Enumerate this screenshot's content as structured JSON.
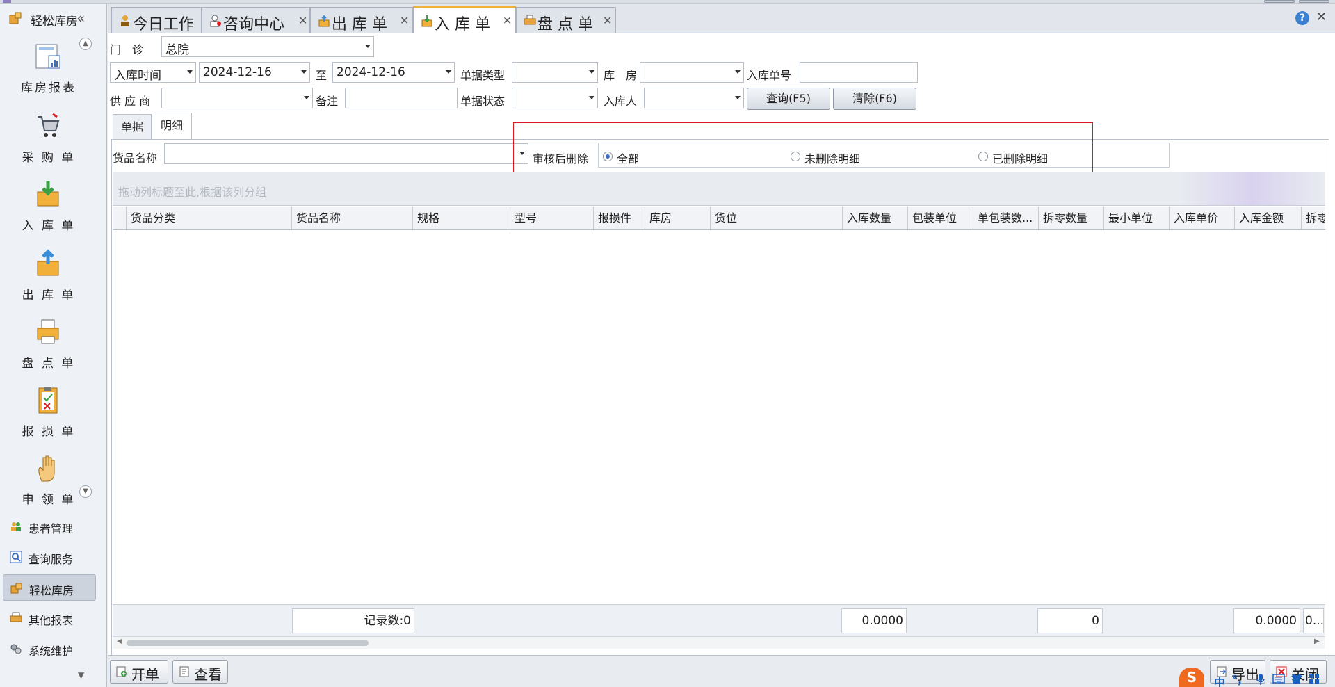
{
  "app": {
    "title": "轻松库房"
  },
  "sidebar": {
    "big_items": [
      {
        "label": "库房报表",
        "icon": "report-chart-icon"
      },
      {
        "label": "采 购 单",
        "icon": "cart-icon"
      },
      {
        "label": "入 库 单",
        "icon": "inbox-in-icon"
      },
      {
        "label": "出 库 单",
        "icon": "inbox-out-icon"
      },
      {
        "label": "盘 点 单",
        "icon": "printer-icon"
      },
      {
        "label": "报 损 单",
        "icon": "clipboard-icon"
      },
      {
        "label": "申 领 单",
        "icon": "hand-icon"
      }
    ],
    "nav_items": [
      {
        "label": "患者管理",
        "icon": "people-icon",
        "active": false
      },
      {
        "label": "查询服务",
        "icon": "search-icon",
        "active": false
      },
      {
        "label": "轻松库房",
        "icon": "warehouse-icon",
        "active": true
      },
      {
        "label": "其他报表",
        "icon": "printer-icon",
        "active": false
      },
      {
        "label": "系统维护",
        "icon": "gears-icon",
        "active": false
      }
    ]
  },
  "tabs": [
    {
      "label": "今日工作",
      "icon": "person-icon",
      "active": false
    },
    {
      "label": "咨询中心",
      "icon": "user-icon",
      "active": false
    },
    {
      "label": "出 库 单",
      "icon": "inbox-out-icon",
      "active": false
    },
    {
      "label": "入 库 单",
      "icon": "inbox-in-icon",
      "active": true
    },
    {
      "label": "盘 点 单",
      "icon": "printer-icon",
      "active": false
    }
  ],
  "filters": {
    "clinic_label": "门　诊",
    "clinic_value": "总院",
    "time_type_value": "入库时间",
    "date_from": "2024-12-16",
    "to_label": "至",
    "date_to": "2024-12-16",
    "doc_type_label": "单据类型",
    "warehouse_label": "库　房",
    "receipt_no_label": "入库单号",
    "supplier_label": "供 应 商",
    "remark_label": "备注",
    "doc_status_label": "单据状态",
    "receiver_label": "入库人",
    "query_button": "查询(F5)",
    "clear_button": "清除(F6)"
  },
  "subtabs": [
    {
      "label": "单据",
      "active": false
    },
    {
      "label": "明细",
      "active": true
    }
  ],
  "detail": {
    "goods_name_label": "货品名称",
    "delete_after_audit_label": "审核后删除",
    "radio_options": [
      {
        "label": "全部",
        "checked": true
      },
      {
        "label": "未删除明细",
        "checked": false
      },
      {
        "label": "已删除明细",
        "checked": false
      }
    ],
    "group_hint": "拖动列标题至此,根据该列分组"
  },
  "grid": {
    "columns": [
      "货品分类",
      "货品名称",
      "规格",
      "型号",
      "报损件",
      "库房",
      "货位",
      "入库数量",
      "包装单位",
      "单包装数...",
      "拆零数量",
      "最小单位",
      "入库单价",
      "入库金额",
      "拆零"
    ],
    "footer": {
      "record_count": "记录数:0",
      "qty_total": "0.0000",
      "split_total": "0",
      "amount_total": "0.0000",
      "last": "0..."
    }
  },
  "toolbar": {
    "new_button": "开单",
    "view_button": "查看",
    "export_button": "导出",
    "close_button": "关闭"
  },
  "ime": {
    "logo": "S",
    "mode": "中",
    "punct": "°,"
  }
}
